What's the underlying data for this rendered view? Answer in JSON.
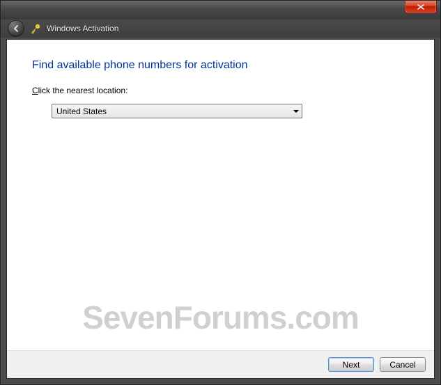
{
  "window": {
    "title": "Windows Activation"
  },
  "page": {
    "heading": "Find available phone numbers for activation",
    "instruction_prefix": "C",
    "instruction_rest": "lick the nearest location:"
  },
  "location": {
    "selected": "United States"
  },
  "buttons": {
    "next": "Next",
    "cancel": "Cancel"
  },
  "watermark": "SevenForums.com"
}
